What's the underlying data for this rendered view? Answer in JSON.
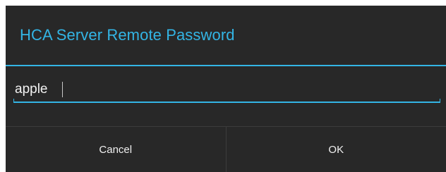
{
  "dialog": {
    "title": "HCA Server Remote Password",
    "password_field": {
      "value": "apple",
      "placeholder": ""
    },
    "buttons": {
      "cancel_label": "Cancel",
      "ok_label": "OK"
    }
  },
  "colors": {
    "accent": "#33b5e5",
    "dialog_background": "#282828",
    "text": "#f0f0f0"
  }
}
